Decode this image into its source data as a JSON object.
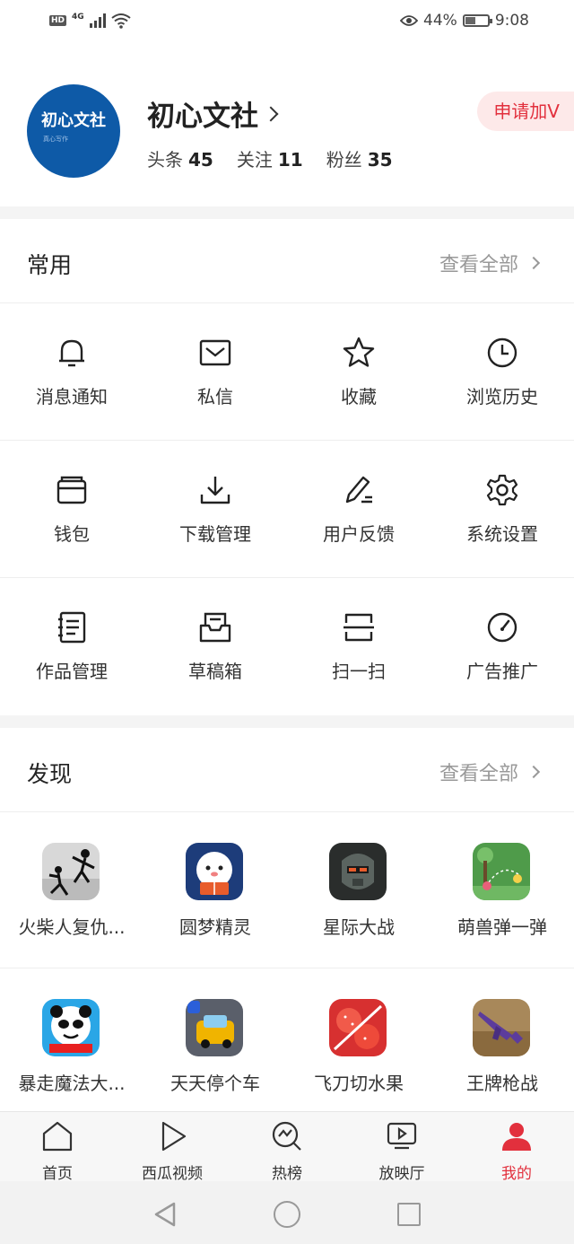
{
  "status_bar": {
    "hd": "HD",
    "network": "4G",
    "battery_percent": "44%",
    "battery_level": 0.44,
    "time": "9:08"
  },
  "profile": {
    "avatar_text": "初心文社",
    "avatar_subtext": "真心写作",
    "name": "初心文社",
    "stats": [
      {
        "label": "头条",
        "value": "45"
      },
      {
        "label": "关注",
        "value": "11"
      },
      {
        "label": "粉丝",
        "value": "35"
      }
    ],
    "apply_v": "申请加V"
  },
  "common": {
    "title": "常用",
    "see_all": "查看全部",
    "items": [
      {
        "label": "消息通知",
        "icon": "bell-icon"
      },
      {
        "label": "私信",
        "icon": "mail-icon"
      },
      {
        "label": "收藏",
        "icon": "star-icon"
      },
      {
        "label": "浏览历史",
        "icon": "clock-icon"
      },
      {
        "label": "钱包",
        "icon": "wallet-icon"
      },
      {
        "label": "下载管理",
        "icon": "download-icon"
      },
      {
        "label": "用户反馈",
        "icon": "pen-icon"
      },
      {
        "label": "系统设置",
        "icon": "gear-icon"
      },
      {
        "label": "作品管理",
        "icon": "notebook-icon"
      },
      {
        "label": "草稿箱",
        "icon": "drafts-icon"
      },
      {
        "label": "扫一扫",
        "icon": "scan-icon"
      },
      {
        "label": "广告推广",
        "icon": "gauge-icon"
      }
    ]
  },
  "discover": {
    "title": "发现",
    "see_all": "查看全部",
    "apps": [
      {
        "label": "火柴人复仇...",
        "icon": "stickman-game-icon",
        "color": "#d8d8d8"
      },
      {
        "label": "圆梦精灵",
        "icon": "sheep-game-icon",
        "color": "#1d3c7a"
      },
      {
        "label": "星际大战",
        "icon": "robot-game-icon",
        "color": "#3b3f3d"
      },
      {
        "label": "萌兽弹一弹",
        "icon": "bounce-game-icon",
        "color": "#4f9b4a"
      },
      {
        "label": "暴走魔法大...",
        "icon": "panda-meme-game-icon",
        "color": "#2aa6e6"
      },
      {
        "label": "天天停个车",
        "icon": "parking-game-icon",
        "color": "#f0b400"
      },
      {
        "label": "飞刀切水果",
        "icon": "fruit-game-icon",
        "color": "#d73030"
      },
      {
        "label": "王牌枪战",
        "icon": "gun-game-icon",
        "color": "#8a6a3e"
      }
    ]
  },
  "bottom_nav": {
    "items": [
      {
        "label": "首页",
        "icon": "home-icon"
      },
      {
        "label": "西瓜视频",
        "icon": "play-icon"
      },
      {
        "label": "热榜",
        "icon": "trending-icon"
      },
      {
        "label": "放映厅",
        "icon": "screen-icon"
      },
      {
        "label": "我的",
        "icon": "person-icon"
      }
    ],
    "active_color": "#e2303d"
  }
}
